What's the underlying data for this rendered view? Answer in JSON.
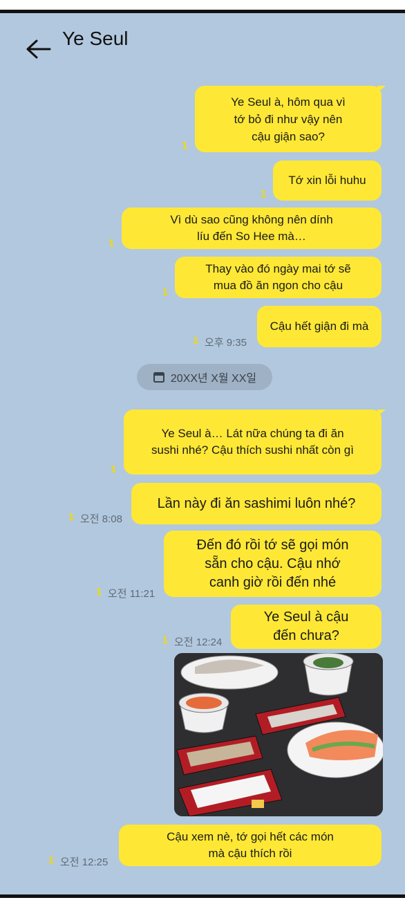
{
  "header": {
    "title": "Ye Seul",
    "back_icon": "arrow-left-icon"
  },
  "messages": [
    {
      "text": "Ye Seul à, hôm qua vì\ntớ bỏ đi như vậy nên\ncậu giận sao?",
      "unread": "1"
    },
    {
      "text": "Tớ xin lỗi huhu",
      "unread": "1"
    },
    {
      "text": "Vì dù sao cũng không nên dính\nlíu đến So Hee mà…",
      "unread": "1"
    },
    {
      "text": "Thay vào đó ngày mai tớ sẽ\nmua đồ ăn ngon cho cậu",
      "unread": "1"
    },
    {
      "text": "Cậu hết giận đi mà",
      "unread": "1",
      "time": "오후 9:35"
    }
  ],
  "date_divider": {
    "text": "20XX년 X월 XX일",
    "icon": "calendar-icon"
  },
  "messages2": [
    {
      "text": "Ye Seul à… Lát nữa chúng ta đi ăn\nsushi nhé? Cậu thích sushi nhất còn gì",
      "unread": "1"
    },
    {
      "text": "Lần này đi ăn sashimi luôn nhé?",
      "unread": "1",
      "time": "오전 8:08"
    },
    {
      "text": "Đến đó rồi tớ sẽ gọi món\nsẵn cho cậu. Cậu nhớ\ncanh giờ rồi đến nhé",
      "unread": "1",
      "time": "오전 11:21"
    },
    {
      "text": "Ye Seul à cậu\nđến chưa?",
      "unread": "1",
      "time": "오전 12:24"
    },
    {
      "text": "Cậu xem nè, tớ gọi hết các món\nmà cậu thích rồi",
      "unread": "1",
      "time": "오전 12:25"
    }
  ],
  "photo": {
    "description_icon": "food-photo-image"
  },
  "colors": {
    "background": "#b2c8de",
    "bubble": "#fee835",
    "unread": "#f3d900"
  }
}
